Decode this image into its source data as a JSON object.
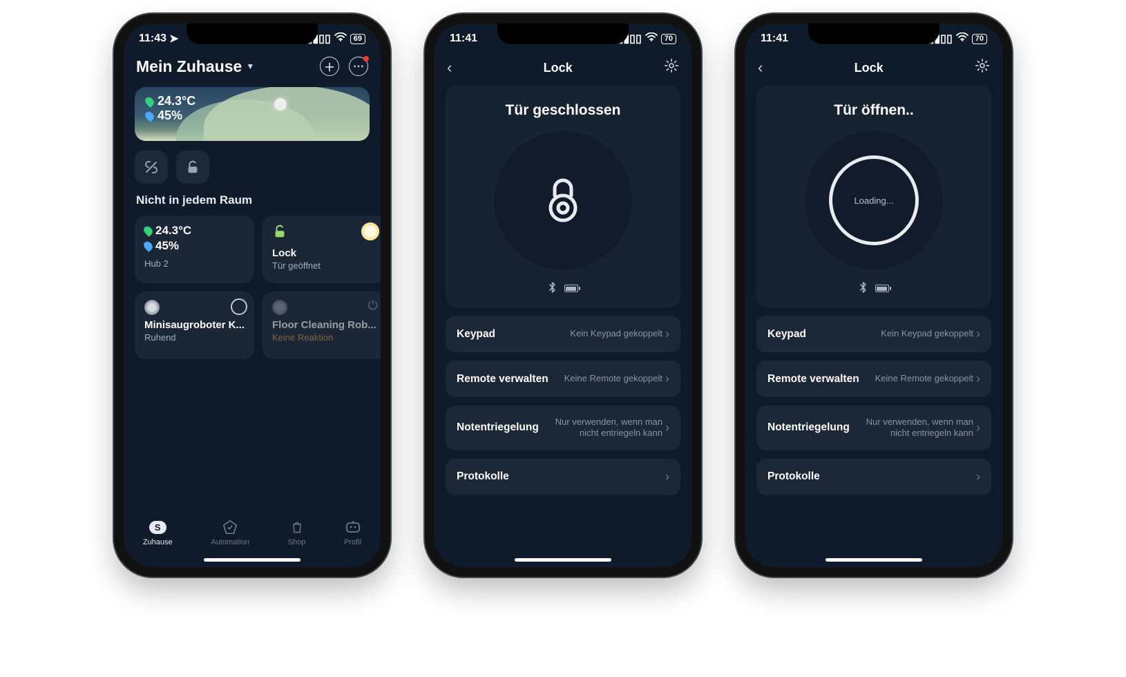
{
  "phone1": {
    "status": {
      "time": "11:43",
      "battery": "69"
    },
    "header": {
      "title": "Mein Zuhause"
    },
    "weather": {
      "temp": "24.3°C",
      "humidity": "45%"
    },
    "section_title": "Nicht in jedem Raum",
    "cards": {
      "hub": {
        "temp": "24.3°C",
        "humidity": "45%",
        "name": "Hub 2"
      },
      "lock": {
        "name": "Lock",
        "state": "Tür geöffnet"
      },
      "robot1": {
        "name": "Minisaugroboter K...",
        "state": "Ruhend"
      },
      "robot2": {
        "name": "Floor Cleaning Rob...",
        "state": "Keine Reaktion"
      }
    },
    "tabs": {
      "home": "Zuhause",
      "auto": "Automation",
      "shop": "Shop",
      "profile": "Profil"
    }
  },
  "phone2": {
    "status": {
      "time": "11:41",
      "battery": "70"
    },
    "title": "Lock",
    "lock_status": "Tür geschlossen",
    "list": {
      "keypad": {
        "l": "Keypad",
        "r": "Kein Keypad gekoppelt"
      },
      "remote": {
        "l": "Remote verwalten",
        "r": "Keine Remote gekoppelt"
      },
      "emergency": {
        "l": "Notentriegelung",
        "r": "Nur verwenden, wenn man nicht entriegeln kann"
      },
      "logs": {
        "l": "Protokolle",
        "r": ""
      }
    }
  },
  "phone3": {
    "status": {
      "time": "11:41",
      "battery": "70"
    },
    "title": "Lock",
    "lock_status": "Tür öffnen..",
    "loading": "Loading...",
    "list": {
      "keypad": {
        "l": "Keypad",
        "r": "Kein Keypad gekoppelt"
      },
      "remote": {
        "l": "Remote verwalten",
        "r": "Keine Remote gekoppelt"
      },
      "emergency": {
        "l": "Notentriegelung",
        "r": "Nur verwenden, wenn man nicht entriegeln kann"
      },
      "logs": {
        "l": "Protokolle",
        "r": ""
      }
    }
  }
}
